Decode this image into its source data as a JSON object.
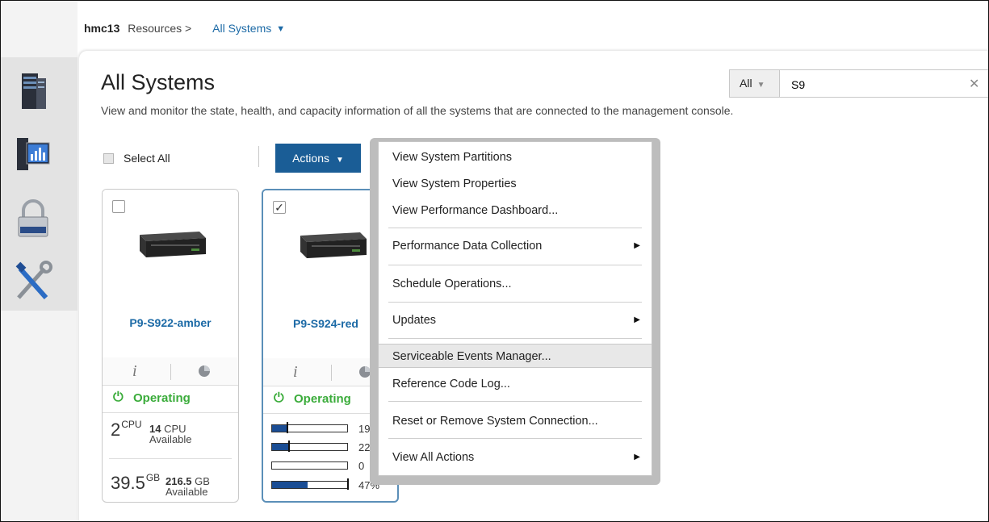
{
  "breadcrumb": {
    "host": "hmc13",
    "resources": "Resources >",
    "current": "All Systems"
  },
  "page": {
    "title": "All Systems",
    "description": "View and monitor the state, health, and capacity information of all the systems that are connected to the management console."
  },
  "search": {
    "filter": "All",
    "value": "S9"
  },
  "toolbar": {
    "select_all": "Select All",
    "actions": "Actions"
  },
  "leftnav": {
    "icons": [
      "server-rack-icon",
      "monitoring-icon",
      "security-lock-icon",
      "tools-icon"
    ]
  },
  "cards": [
    {
      "name": "P9-S922-amber",
      "selected": false,
      "status": "Operating",
      "cpu": {
        "value": "2",
        "unit": "CPU",
        "available_value": "14",
        "available_unit": "CPU",
        "available_label": "Available"
      },
      "memory": {
        "value": "39.5",
        "unit": "GB",
        "available_value": "216.5",
        "available_unit": "GB",
        "available_label": "Available"
      }
    },
    {
      "name": "P9-S924-red",
      "selected": true,
      "status": "Operating",
      "bars": [
        {
          "label": "19",
          "fill": 0.19
        },
        {
          "label": "22",
          "fill": 0.22
        },
        {
          "label": "0",
          "fill": 0.0
        },
        {
          "label": "47%",
          "fill": 0.47
        }
      ]
    }
  ],
  "actions_menu": {
    "items": [
      {
        "label": "View System Partitions",
        "submenu": false
      },
      {
        "label": "View System Properties",
        "submenu": false
      },
      {
        "label": "View Performance Dashboard...",
        "submenu": false
      },
      {
        "label": "Performance Data Collection",
        "submenu": true
      },
      {
        "label": "Schedule Operations...",
        "submenu": false
      },
      {
        "label": "Updates",
        "submenu": true
      },
      {
        "label": "Serviceable Events Manager...",
        "submenu": false,
        "highlighted": true
      },
      {
        "label": "Reference Code Log...",
        "submenu": false
      },
      {
        "label": "Reset or Remove System Connection...",
        "submenu": false
      },
      {
        "label": "View All Actions",
        "submenu": true
      }
    ]
  },
  "colors": {
    "accent": "#1a5d96",
    "link": "#1c6aa6",
    "status_ok": "#3bac3b",
    "bar_fill": "#1a4d94"
  }
}
